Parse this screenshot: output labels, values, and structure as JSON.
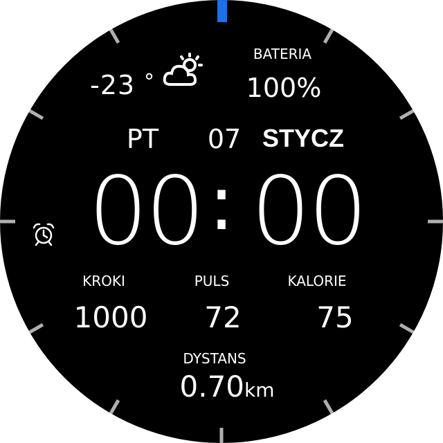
{
  "weather": {
    "temperature": "-23",
    "unit": "°",
    "icon": "partly-cloudy-icon"
  },
  "battery": {
    "label": "BATERIA",
    "value": "100%"
  },
  "date": {
    "day": "PT",
    "number": "07",
    "month": "STYCZ"
  },
  "time": {
    "hours": "00",
    "separator": ":",
    "minutes": "00"
  },
  "alarm": {
    "icon": "alarm-clock-icon"
  },
  "stats": {
    "steps_label": "KROKI",
    "steps_value": "1000",
    "pulse_label": "PULS",
    "pulse_value": "72",
    "calories_label": "KALORIE",
    "calories_value": "75"
  },
  "distance": {
    "label": "DYSTANS",
    "value": "0.70",
    "unit": "km"
  },
  "colors": {
    "background": "#000000",
    "text": "#ffffff",
    "accent": "#1e6fe8",
    "tick": "#b0b0b0"
  }
}
